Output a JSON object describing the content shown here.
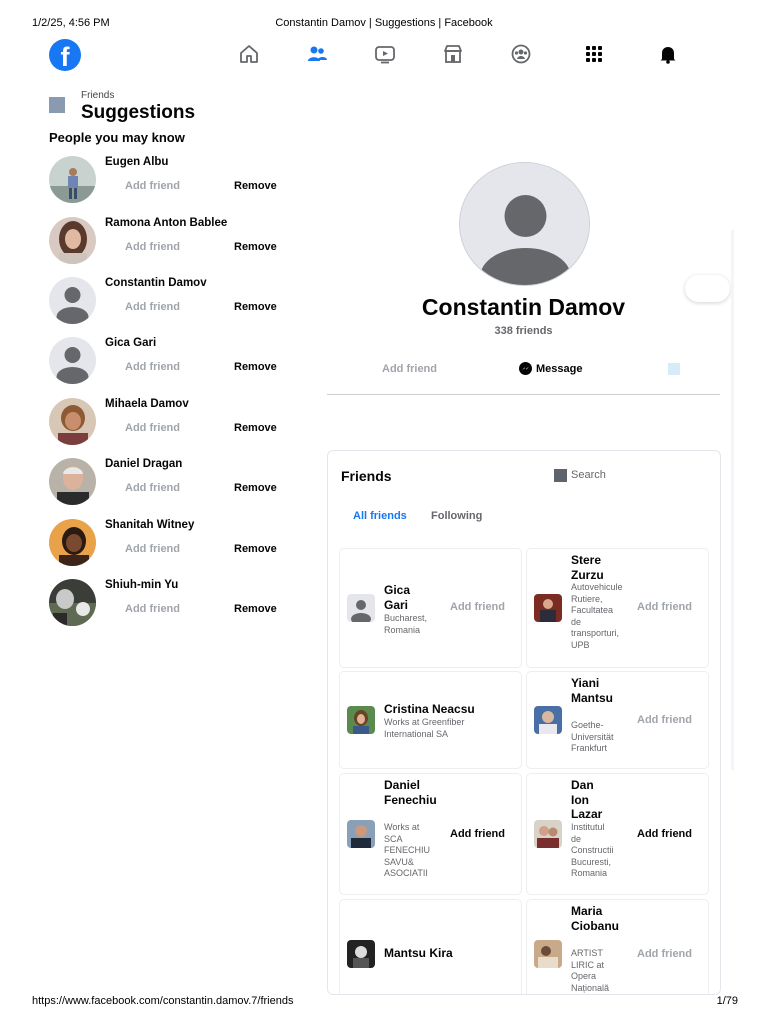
{
  "print": {
    "datetime": "1/2/25, 4:56 PM",
    "doc_title": "Constantin Damov | Suggestions | Facebook",
    "url": "https://www.facebook.com/constantin.damov.7/friends",
    "page": "1/79"
  },
  "nav": {
    "logo": "f",
    "icons": [
      "home-icon",
      "friends-icon",
      "watch-icon",
      "marketplace-icon",
      "groups-icon",
      "menu-grid-icon",
      "notifications-icon"
    ],
    "active_color": "#1877f2"
  },
  "left": {
    "breadcrumb": "Friends",
    "title": "Suggestions",
    "subtitle": "People you may know",
    "add_label": "Add friend",
    "remove_label": "Remove",
    "suggestions": [
      {
        "name": "Eugen Albu"
      },
      {
        "name": "Ramona Anton Bablee"
      },
      {
        "name": "Constantin Damov"
      },
      {
        "name": "Gica Gari"
      },
      {
        "name": "Mihaela Damov"
      },
      {
        "name": "Daniel Dragan"
      },
      {
        "name": "Shanitah Witney"
      },
      {
        "name": "Shiuh-min Yu"
      }
    ]
  },
  "profile": {
    "name": "Constantin Damov",
    "friends_count": "338 friends",
    "add_label": "Add friend",
    "message_label": "Message"
  },
  "friends_card": {
    "title": "Friends",
    "search_label": "Search",
    "tab_all": "All friends",
    "tab_following": "Following",
    "add_label": "Add friend",
    "items": [
      {
        "name": "Gica Gari",
        "sub": "Bucharest, Romania"
      },
      {
        "name": "Stere Zurzu",
        "sub": "Autovehicule Rutiere, Facultatea de transporturi, UPB"
      },
      {
        "name": "Cristina Neacsu",
        "sub": "Works at Greenfiber International SA"
      },
      {
        "name": "Yiani Mantsu",
        "sub": "Goethe-Universität Frankfurt"
      },
      {
        "name": "Daniel Fenechiu",
        "sub": "Works at SCA FENECHIU SAVU& ASOCIATII"
      },
      {
        "name": "Dan Ion Lazar",
        "sub": "Institutul de Constructii Bucuresti, Romania"
      },
      {
        "name": "Mantsu Kira",
        "sub": ""
      },
      {
        "name": "Maria Ciobanu",
        "sub": "ARTIST LIRIC at Opera Națională"
      }
    ]
  }
}
